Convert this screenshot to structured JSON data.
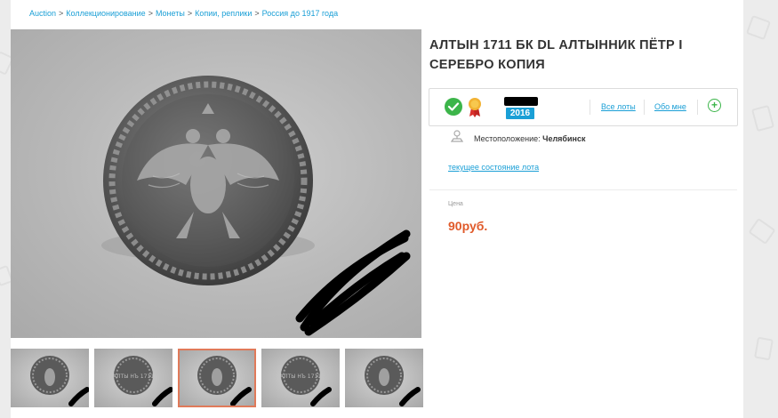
{
  "breadcrumb": [
    {
      "label": "Auction"
    },
    {
      "label": "Коллекционирование"
    },
    {
      "label": "Монеты"
    },
    {
      "label": "Копии, реплики"
    },
    {
      "label": "Россия до 1917 года"
    }
  ],
  "breadcrumb_separator": ">",
  "lot": {
    "title": "АЛТЫН 1711 БК DL АЛТЫННИК ПЁТР I СЕРЕБРО КОПИЯ",
    "coin_legend": "АЛТЫ НЪ 1711"
  },
  "seller": {
    "year": "2016",
    "all_lots": "Все лоты",
    "about_me": "Обо мне",
    "follow_icon": "plus-circle-icon"
  },
  "location": {
    "label": "Местоположение:",
    "value": "Челябинск"
  },
  "status_link": "текущее состояние лота",
  "price": {
    "label": "Цена",
    "value": "90руб."
  },
  "gallery": {
    "active_index": 2,
    "thumbs": [
      "obverse",
      "reverse",
      "obverse",
      "reverse",
      "obverse"
    ]
  },
  "colors": {
    "link": "#1a9fd6",
    "price": "#e05a2a",
    "verified": "#3cb54a",
    "badge": "#1a9fd6",
    "active_thumb_border": "#e07a5a"
  }
}
